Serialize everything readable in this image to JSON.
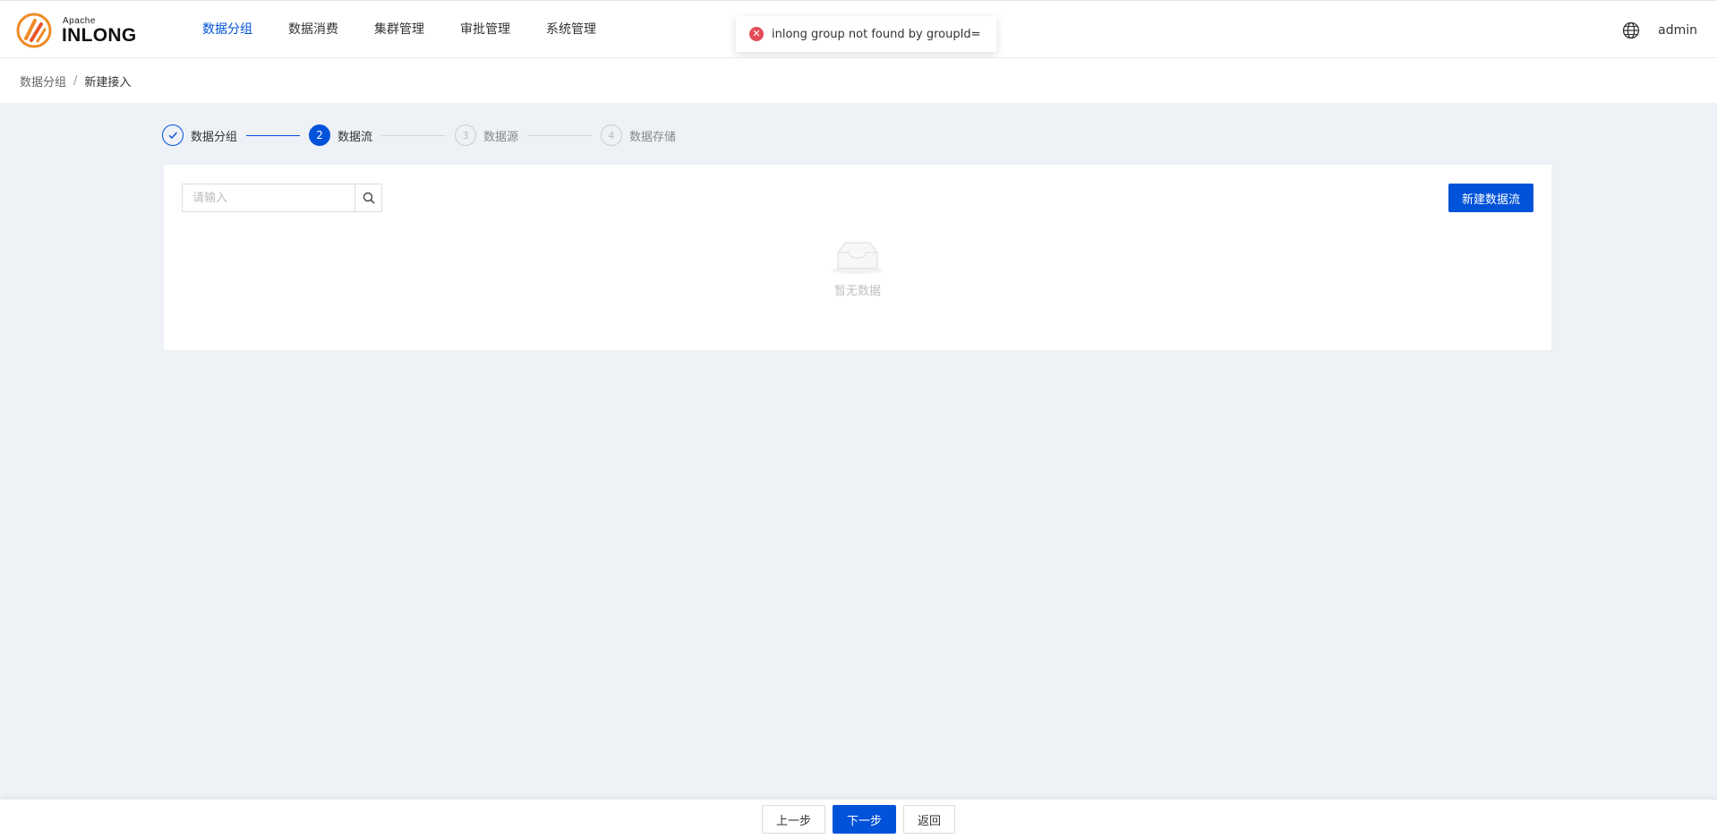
{
  "header": {
    "logo_top": "Apache",
    "logo_main": "INLONG",
    "nav": [
      {
        "label": "数据分组",
        "active": true
      },
      {
        "label": "数据消费"
      },
      {
        "label": "集群管理"
      },
      {
        "label": "审批管理"
      },
      {
        "label": "系统管理"
      }
    ],
    "user": "admin"
  },
  "toast": {
    "type": "error",
    "message": "inlong group not found by groupId="
  },
  "breadcrumb": {
    "parent": "数据分组",
    "separator": "/",
    "current": "新建接入"
  },
  "steps": [
    {
      "number": "1",
      "label": "数据分组",
      "status": "done"
    },
    {
      "number": "2",
      "label": "数据流",
      "status": "current"
    },
    {
      "number": "3",
      "label": "数据源",
      "status": "wait"
    },
    {
      "number": "4",
      "label": "数据存储",
      "status": "wait"
    }
  ],
  "panel": {
    "search_placeholder": "请输入",
    "create_button": "新建数据流",
    "empty_text": "暂无数据"
  },
  "footer": {
    "prev": "上一步",
    "next": "下一步",
    "back": "返回"
  },
  "colors": {
    "primary": "#0052d9",
    "error": "#e34d59",
    "background": "#eef1f6"
  }
}
